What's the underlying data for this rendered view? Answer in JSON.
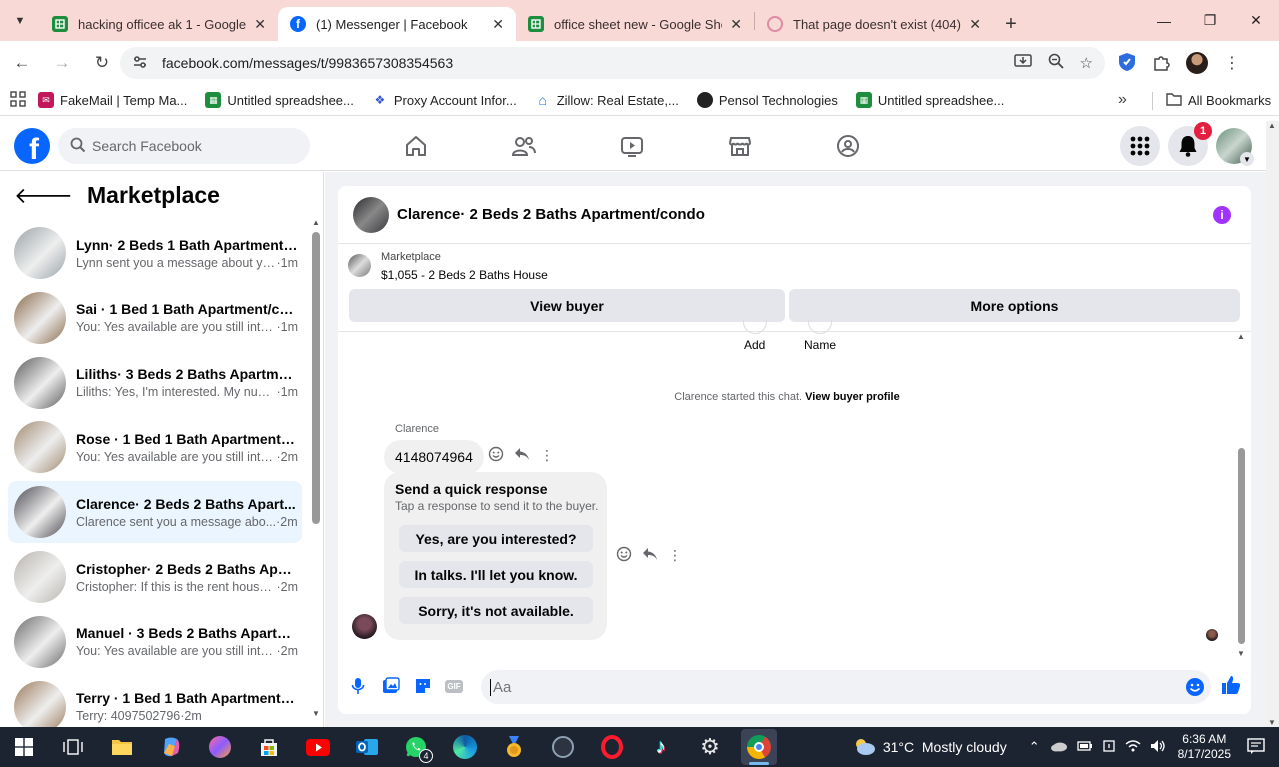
{
  "browser": {
    "tabs": [
      {
        "title": "hacking officee ak 1 - Google D",
        "favicon": "sheets-icon",
        "active": false
      },
      {
        "title": "(1) Messenger | Facebook",
        "favicon": "facebook-icon",
        "active": true
      },
      {
        "title": "office sheet new - Google Shee",
        "favicon": "sheets-icon",
        "active": false
      },
      {
        "title": "That page doesn't exist (404) - I",
        "favicon": "dribbble-icon",
        "active": false
      }
    ],
    "url": "facebook.com/messages/t/9983657308354563",
    "bookmarks": [
      {
        "label": "FakeMail | Temp Ma...",
        "icon": "fakemail-icon"
      },
      {
        "label": "Untitled spreadshee...",
        "icon": "sheets-icon"
      },
      {
        "label": "Proxy Account Infor...",
        "icon": "proxy-icon"
      },
      {
        "label": "Zillow: Real Estate,...",
        "icon": "zillow-icon"
      },
      {
        "label": "Pensol Technologies",
        "icon": "pensol-icon"
      },
      {
        "label": "Untitled spreadshee...",
        "icon": "sheets-icon"
      }
    ],
    "bookmarks_more": "»",
    "all_bookmarks": "All Bookmarks"
  },
  "facebook": {
    "search_placeholder": "Search Facebook",
    "notification_count": "1"
  },
  "sidebar": {
    "title": "Marketplace",
    "conversations": [
      {
        "name": "Lynn· 2 Beds 1 Bath Apartment/...",
        "preview": "Lynn sent you a message about yo...",
        "time": "·1m",
        "selected": false,
        "color": "#9aa3a8"
      },
      {
        "name": "Sai · 1 Bed 1 Bath Apartment/co...",
        "preview": "You: Yes available are you still inter...",
        "time": "·1m",
        "selected": false,
        "color": "#8a6a4a"
      },
      {
        "name": "Liliths· 3 Beds 2 Baths Apartmen...",
        "preview": "Liliths: Yes, I'm interested. My num...",
        "time": "·1m",
        "selected": false,
        "color": "#5a5a5a"
      },
      {
        "name": "Rose · 1 Bed 1 Bath Apartment/c...",
        "preview": "You: Yes available are you still inter...",
        "time": "·2m",
        "selected": false,
        "color": "#a08a70"
      },
      {
        "name": "Clarence· 2 Beds 2 Baths Apart...",
        "preview": "Clarence sent you a message abo...",
        "time": "·2m",
        "selected": true,
        "color": "#4a4a52"
      },
      {
        "name": "Cristopher· 2 Beds 2 Baths Apar...",
        "preview": "Cristopher: If this is the rent house...",
        "time": "·2m",
        "selected": false,
        "color": "#b8b4ae"
      },
      {
        "name": "Manuel · 3 Beds 2 Baths Apartm...",
        "preview": "You: Yes available are you still inter...",
        "time": "·2m",
        "selected": false,
        "color": "#6a6a6a"
      },
      {
        "name": "Terry · 1 Bed 1 Bath Apartment/c...",
        "preview": "Terry: 4097502796",
        "time": "·2m",
        "selected": false,
        "color": "#9a7a5a"
      }
    ]
  },
  "chat": {
    "title": "Clarence· 2 Beds 2 Baths Apartment/condo",
    "listing_source": "Marketplace",
    "listing_price": "$1,055 - 2 Beds 2 Baths House",
    "view_buyer": "View buyer",
    "more_options": "More options",
    "add_label": "Add",
    "name_label": "Name",
    "started_text": "Clarence started this chat.",
    "view_profile": "View buyer profile",
    "sender": "Clarence",
    "message": "4148074964",
    "quick_title": "Send a quick response",
    "quick_sub": "Tap a response to send it to the buyer.",
    "quick_responses": [
      "Yes, are you interested?",
      "In talks. I'll let you know.",
      "Sorry, it's not available."
    ],
    "composer_placeholder": "Aa"
  },
  "taskbar": {
    "weather": "31°C  Mostly cloudy",
    "time": "6:36 AM",
    "date": "8/17/2025",
    "whatsapp_badge": "4"
  }
}
